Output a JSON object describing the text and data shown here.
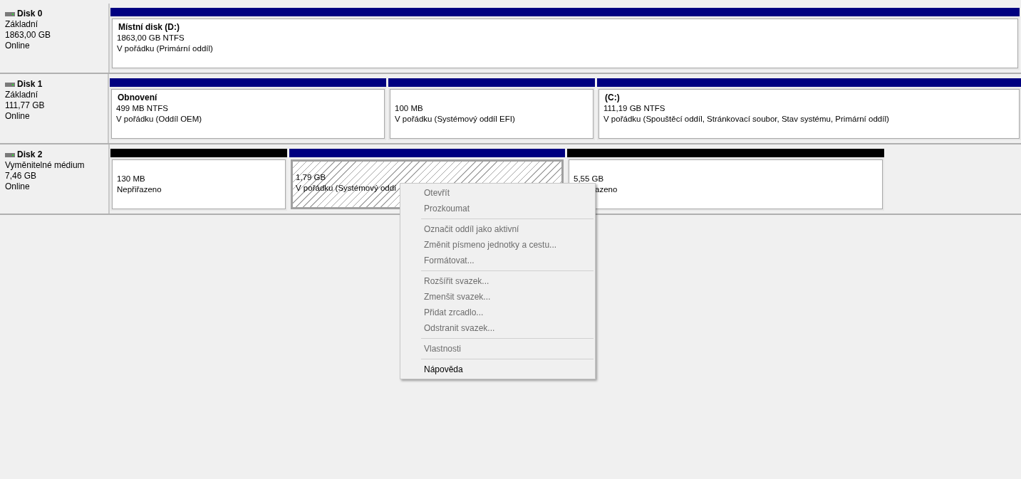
{
  "disks": [
    {
      "name": "Disk 0",
      "type": "Základní",
      "size": "1863,00 GB",
      "status": "Online",
      "partitions": [
        {
          "title": "Místní disk  (D:)",
          "size": "1863,00 GB NTFS",
          "status": "V pořádku (Primární oddíl)",
          "color": "#000080",
          "selected": false
        }
      ]
    },
    {
      "name": "Disk 1",
      "type": "Základní",
      "size": "111,77 GB",
      "status": "Online",
      "partitions": [
        {
          "title": "Obnovení",
          "size": "499 MB NTFS",
          "status": "V pořádku (Oddíl OEM)",
          "color": "#000080",
          "selected": false
        },
        {
          "size": "100 MB",
          "status": "V pořádku (Systémový oddíl EFI)",
          "color": "#000080",
          "selected": false
        },
        {
          "title": "(C:)",
          "size": "111,19 GB NTFS",
          "status": "V pořádku (Spouštěcí oddíl, Stránkovací soubor, Stav systému, Primární oddíl)",
          "color": "#000080",
          "selected": false
        }
      ]
    },
    {
      "name": "Disk 2",
      "type": "Vyměnitelné médium",
      "size": "7,46 GB",
      "status": "Online",
      "partitions": [
        {
          "size": "130 MB",
          "status": "Nepřiřazeno",
          "color": "#000000",
          "selected": false
        },
        {
          "size": "1,79 GB",
          "status": "V pořádku (Systémový oddí",
          "color": "#000080",
          "selected": true
        },
        {
          "size": "5,55 GB",
          "status": "azeno",
          "color": "#000000",
          "selected": false,
          "covered": true
        }
      ]
    }
  ],
  "context_menu": {
    "groups": [
      [
        {
          "label": "Otevřít",
          "disabled": true
        },
        {
          "label": "Prozkoumat",
          "disabled": true
        }
      ],
      [
        {
          "label": "Označit oddíl jako aktivní",
          "disabled": true
        },
        {
          "label": "Změnit písmeno jednotky a cestu...",
          "disabled": true
        },
        {
          "label": "Formátovat...",
          "disabled": true
        }
      ],
      [
        {
          "label": "Rozšířit svazek...",
          "disabled": true
        },
        {
          "label": "Zmenšit svazek...",
          "disabled": true
        },
        {
          "label": "Přidat zrcadlo...",
          "disabled": true
        },
        {
          "label": "Odstranit svazek...",
          "disabled": true
        }
      ],
      [
        {
          "label": "Vlastnosti",
          "disabled": true
        }
      ],
      [
        {
          "label": "Nápověda",
          "disabled": false
        }
      ]
    ]
  }
}
